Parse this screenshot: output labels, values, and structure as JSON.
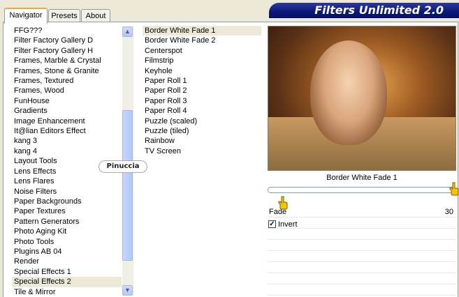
{
  "header": {
    "title": "Filters Unlimited 2.0"
  },
  "tabs": [
    {
      "label": "Navigator",
      "active": true
    },
    {
      "label": "Presets",
      "active": false
    },
    {
      "label": "About",
      "active": false
    }
  ],
  "categories": {
    "items": [
      "FFG???",
      "Filter Factory Gallery D",
      "Filter Factory Gallery H",
      "Frames, Marble & Crystal",
      "Frames, Stone & Granite",
      "Frames, Textured",
      "Frames, Wood",
      "FunHouse",
      "Gradients",
      "Image Enhancement",
      "It@lian Editors Effect",
      "kang 3",
      "kang 4",
      "Layout Tools",
      "Lens Effects",
      "Lens Flares",
      "Noise Filters",
      "Paper Backgrounds",
      "Paper Textures",
      "Pattern Generators",
      "Photo Aging Kit",
      "Photo Tools",
      "Plugins AB 04",
      "Render",
      "Special Effects 1",
      "Special Effects 2",
      "Tile & Mirror"
    ],
    "selected": "Special Effects 2"
  },
  "filters": {
    "items": [
      "Border White Fade 1",
      "Border White Fade 2",
      "Centerspot",
      "Filmstrip",
      "Keyhole",
      "Paper Roll 1",
      "Paper Roll 2",
      "Paper Roll 3",
      "Paper Roll 4",
      "Puzzle (scaled)",
      "Puzzle (tiled)",
      "Rainbow",
      "TV Screen"
    ],
    "selected": "Border White Fade 1"
  },
  "preview": {
    "caption": "Border White Fade 1"
  },
  "params": {
    "fade_label": "Fade",
    "fade_value": "30",
    "invert_label": "Invert",
    "invert_checked": true
  },
  "watermark": "Pinuccia",
  "icons": {
    "scroll_up": "chevron-up-icon",
    "scroll_down": "chevron-down-icon",
    "pointer": "hand-pointer-icon"
  },
  "colors": {
    "header_bg": "#0a1878",
    "tab_accent": "#f3a33c",
    "selection_bg": "#ece9d8",
    "scrollbar": "#b7cbf7"
  }
}
